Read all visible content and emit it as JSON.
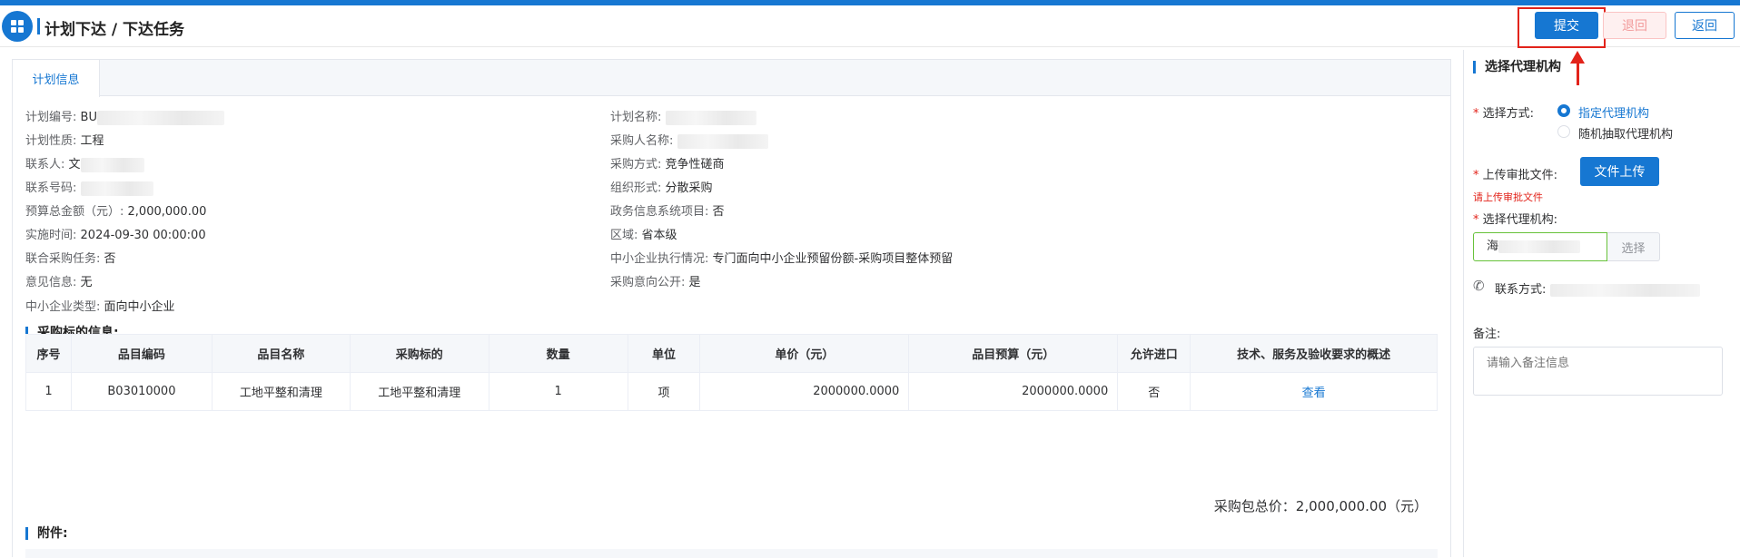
{
  "header": {
    "title": "计划下达 / 下达任务",
    "submit": "提交",
    "back": "退回",
    "return": "返回"
  },
  "tabs": [
    {
      "label": "计划信息"
    }
  ],
  "plan": {
    "plan_no_label": "计划编号:",
    "plan_no_value": "BU",
    "plan_name_label": "计划名称:",
    "nature_label": "计划性质:",
    "nature_value": "工程",
    "purchaser_label": "采购人名称:",
    "contact_label": "联系人:",
    "contact_value": "文",
    "method_label": "采购方式:",
    "method_value": "竞争性磋商",
    "phone_label": "联系号码:",
    "org_label": "组织形式:",
    "org_value": "分散采购",
    "budget_label": "预算总金额（元）:",
    "budget_value": "2,000,000.00",
    "gov_label": "政务信息系统项目:",
    "gov_value": "否",
    "time_label": "实施时间:",
    "time_value": "2024-09-30 00:00:00",
    "region_label": "区域:",
    "region_value": "省本级",
    "joint_label": "联合采购任务:",
    "joint_value": "否",
    "sme_exec_label": "中小企业执行情况:",
    "sme_exec_value": "专门面向中小企业预留份额-采购项目整体预留",
    "opinion_label": "意见信息:",
    "opinion_value": "无",
    "intent_label": "采购意向公开:",
    "intent_value": "是",
    "sme_type_label": "中小企业类型:",
    "sme_type_value": "面向中小企业"
  },
  "items_section": {
    "title": "采购标的信息:",
    "columns": [
      "序号",
      "品目编码",
      "品目名称",
      "采购标的",
      "数量",
      "单位",
      "单价（元）",
      "品目预算（元）",
      "允许进口",
      "技术、服务及验收要求的概述"
    ],
    "rows": [
      {
        "no": "1",
        "code": "B03010000",
        "name": "工地平整和清理",
        "target": "工地平整和清理",
        "qty": "1",
        "unit": "项",
        "price": "2000000.0000",
        "budget": "2000000.0000",
        "import": "否",
        "action": "查看"
      }
    ],
    "total": "采购包总价：2,000,000.00（元）"
  },
  "attachments": {
    "title": "附件:"
  },
  "side": {
    "title": "选择代理机构",
    "mode_label": "选择方式:",
    "options": [
      "指定代理机构",
      "随机抽取代理机构"
    ],
    "selected_option": 0,
    "upload_label": "上传审批文件:",
    "upload_button": "文件上传",
    "upload_error": "请上传审批文件",
    "agency_label": "选择代理机构:",
    "agency_value": "海",
    "agency_select": "选择",
    "contact_label": "联系方式:",
    "remark_label": "备注:",
    "remark_placeholder": "请输入备注信息"
  },
  "colors": {
    "primary": "#1677d2",
    "danger": "#e2231a",
    "success": "#67c23a"
  }
}
